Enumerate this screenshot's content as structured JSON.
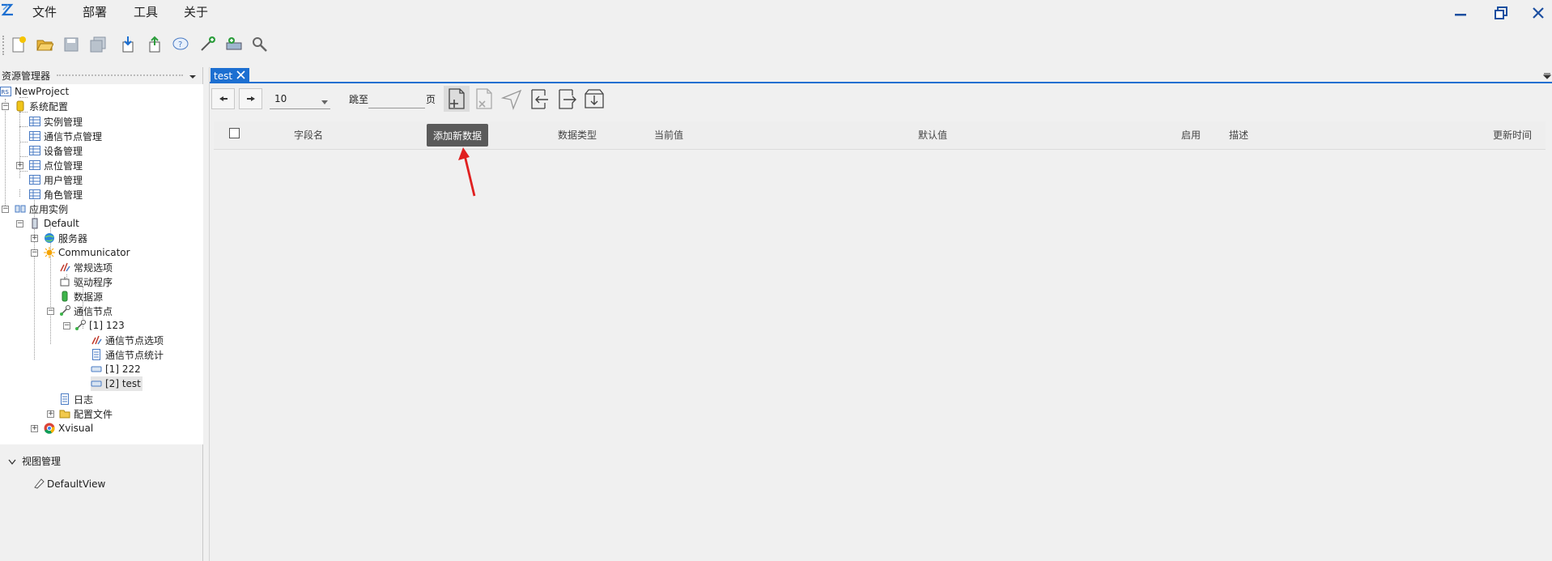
{
  "menu": {
    "items": [
      "文件",
      "部署",
      "工具",
      "关于"
    ]
  },
  "toolbar": {
    "icons": [
      "new-file-icon",
      "open-folder-icon",
      "save-icon",
      "save-all-icon",
      "import-icon",
      "export-icon",
      "help-icon",
      "add-node-icon",
      "add-device-icon",
      "settings-tool-icon"
    ]
  },
  "explorer": {
    "title": "资源管理器",
    "tree": {
      "root": "NewProject",
      "system_config": "系统配置",
      "system_children": [
        "实例管理",
        "通信节点管理",
        "设备管理",
        "点位管理",
        "用户管理",
        "角色管理"
      ],
      "app_instance": "应用实例",
      "default": "Default",
      "server": "服务器",
      "communicator": "Communicator",
      "comm_children": [
        "常规选项",
        "驱动程序",
        "数据源"
      ],
      "comm_node": "通信节点",
      "node_123": "[1] 123",
      "node_children": [
        "通信节点选项",
        "通信节点统计",
        "[1] 222",
        "[2] test"
      ],
      "log": "日志",
      "config_files": "配置文件",
      "xvisual": "Xvisual"
    }
  },
  "view_manager": {
    "title": "视图管理",
    "item": "DefaultView"
  },
  "doc_tab": {
    "label": "test"
  },
  "pager": {
    "page_size": "10",
    "jump_label": "跳至",
    "page_label": "页"
  },
  "tooltip": "添加新数据",
  "grid": {
    "columns": [
      "字段名",
      "数据类型",
      "当前值",
      "默认值",
      "启用",
      "描述",
      "更新时间"
    ]
  }
}
